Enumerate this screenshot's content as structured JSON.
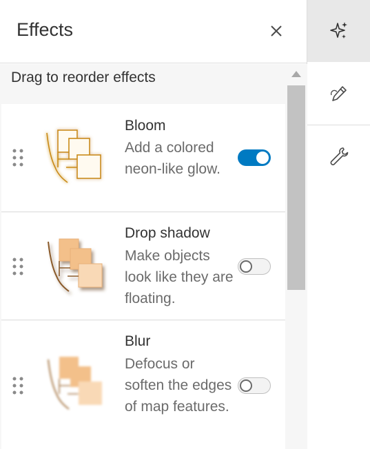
{
  "panel": {
    "title": "Effects",
    "close_icon": "close-icon",
    "hint": "Drag to reorder effects"
  },
  "effects": [
    {
      "title": "Bloom",
      "desc": "Add a colored neon-like glow.",
      "enabled": true,
      "icon": "bloom-thumbnail"
    },
    {
      "title": "Drop shadow",
      "desc": "Make objects look like they are floating.",
      "enabled": false,
      "icon": "drop-shadow-thumbnail"
    },
    {
      "title": "Blur",
      "desc": "Defocus or soften the edges of map features.",
      "enabled": false,
      "icon": "blur-thumbnail"
    }
  ],
  "rail": {
    "items": [
      {
        "icon": "sparkle-icon",
        "active": true
      },
      {
        "icon": "pen-icon",
        "active": false
      },
      {
        "icon": "wrench-icon",
        "active": false
      }
    ]
  },
  "colors": {
    "accent": "#007ac2",
    "bloom_stroke": "#c98a16",
    "shadow_fill": "#f3c08a",
    "shadow_stroke": "#8a5a2a"
  }
}
